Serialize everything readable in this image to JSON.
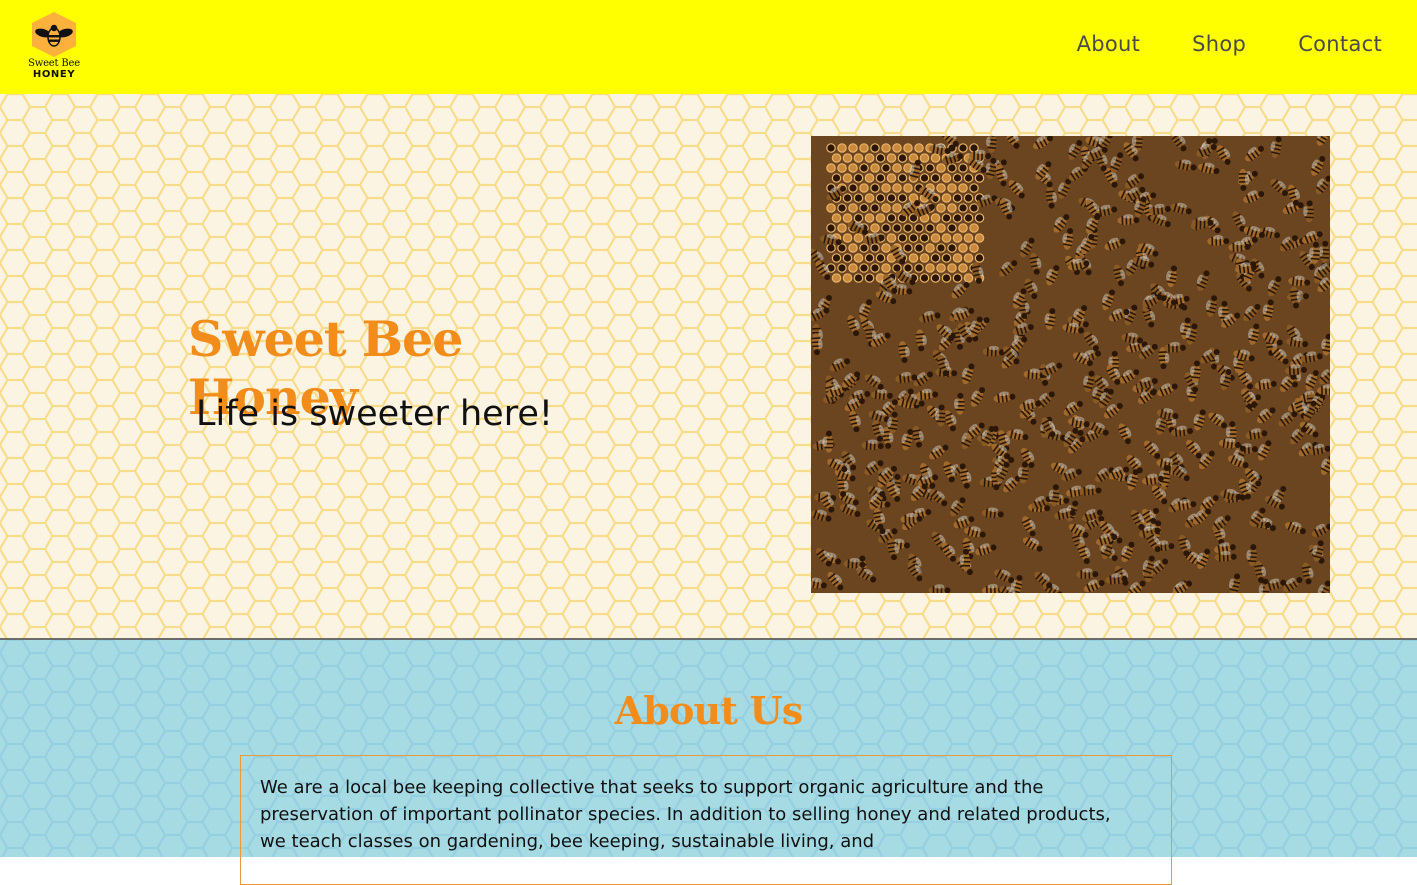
{
  "header": {
    "logo": {
      "brand_line1": "Sweet Bee",
      "brand_line2": "HONEY",
      "colors": {
        "hex": "#fbb13c",
        "bee": "#111111"
      }
    },
    "nav": [
      {
        "label": "About"
      },
      {
        "label": "Shop"
      },
      {
        "label": "Contact"
      }
    ],
    "background": "#ffff00"
  },
  "hero": {
    "title": "Sweet Bee Honey",
    "subtitle": "Life is sweeter here!",
    "image_alt": "honeycomb-with-bees-photo",
    "colors": {
      "title": "#f28c1a",
      "background": "#fbf4e2",
      "pattern": "#f7dc8c"
    }
  },
  "about": {
    "title": "About Us",
    "body": "We are a local bee keeping collective that seeks to support organic agriculture and the preservation of important pollinator species. In addition to selling honey and related products, we teach classes on gardening, bee keeping, sustainable living, and",
    "colors": {
      "background": "#a6dbe4",
      "title": "#f28c1a",
      "border": "#e89b3a"
    }
  }
}
